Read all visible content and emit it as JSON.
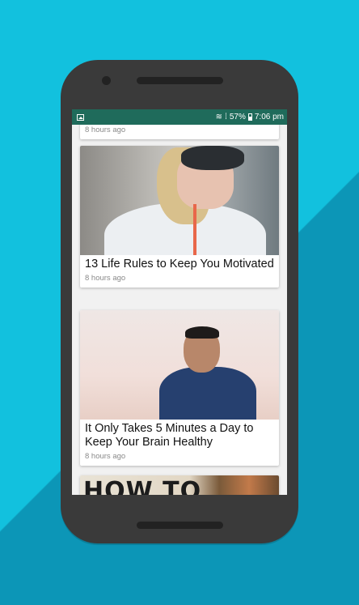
{
  "status_bar": {
    "battery": "57%",
    "time": "7:06 pm"
  },
  "feed": {
    "items": [
      {
        "title": "",
        "time": "8 hours ago"
      },
      {
        "title": "13 Life Rules to Keep You Motivated",
        "time": "8 hours ago"
      },
      {
        "title": "It Only Takes 5 Minutes a Day to Keep Your Brain Healthy",
        "time": "8 hours ago"
      },
      {
        "title": "",
        "time": ""
      }
    ],
    "image_text": "HOW TO"
  },
  "colors": {
    "background": "#12c1de",
    "phone_body": "#3a3a3a",
    "status_bar": "#1f6b5b"
  }
}
